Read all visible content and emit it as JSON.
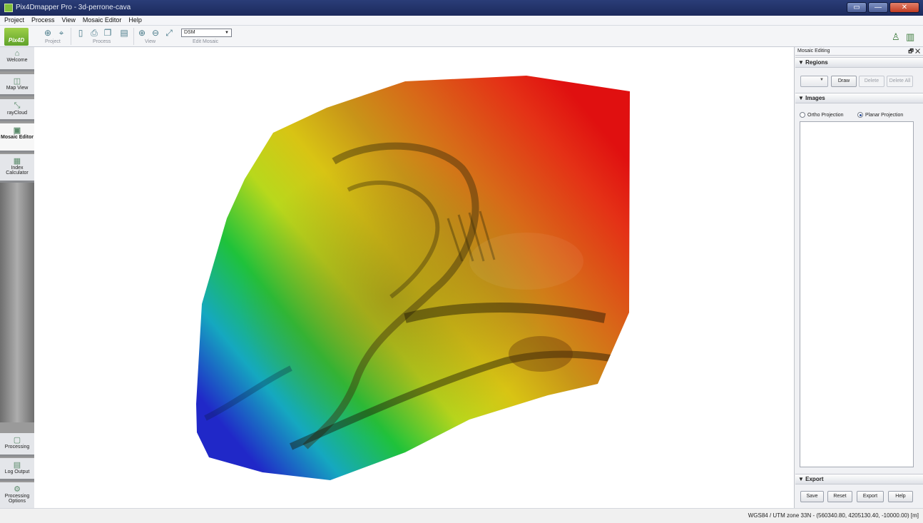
{
  "window": {
    "title": "Pix4Dmapper Pro - 3d-perrone-cava",
    "controls": {
      "restore": "▭",
      "minimize": "—",
      "close": "✕"
    }
  },
  "menu": [
    "Project",
    "Process",
    "View",
    "Mosaic Editor",
    "Help"
  ],
  "toolbar": {
    "logo_text": "Pix4D",
    "groups": {
      "project": "Project",
      "process": "Process",
      "view": "View",
      "edit_mosaic": "Edit Mosaic"
    },
    "layer_select": "DSM"
  },
  "sidebar": {
    "items": [
      {
        "label": "Welcome",
        "icon": "home-icon"
      },
      {
        "label": "Map View",
        "icon": "map-icon"
      },
      {
        "label": "rayCloud",
        "icon": "raycloud-icon"
      },
      {
        "label": "Mosaic Editor",
        "icon": "mosaic-icon"
      },
      {
        "label": "Index Calculator",
        "icon": "index-icon"
      },
      {
        "label": "Processing",
        "icon": "processing-icon"
      },
      {
        "label": "Log Output",
        "icon": "log-icon"
      },
      {
        "label": "Processing Options",
        "icon": "gear-icon"
      }
    ],
    "active": "Mosaic Editor"
  },
  "panel": {
    "title": "Mosaic Editing",
    "controls": "🗗 ✕",
    "regions": {
      "header": "▼ Regions",
      "draw": "Draw",
      "delete": "Delete",
      "delete_all": "Delete All"
    },
    "images": {
      "header": "▼ Images",
      "ortho": "Ortho Projection",
      "planar": "Planar Projection",
      "selected": "Planar Projection"
    },
    "export": {
      "header": "▼ Export",
      "save": "Save",
      "reset": "Reset",
      "export": "Export",
      "help": "Help"
    }
  },
  "status": {
    "coordinates": "WGS84 / UTM zone 33N - (560340.80, 4205130.40, -10000.00) [m]"
  },
  "colors": {
    "title_bar": "#1c2a5c",
    "accent_green": "#7fbf3a",
    "dsm_low": "#2020c8",
    "dsm_high": "#e01010"
  }
}
